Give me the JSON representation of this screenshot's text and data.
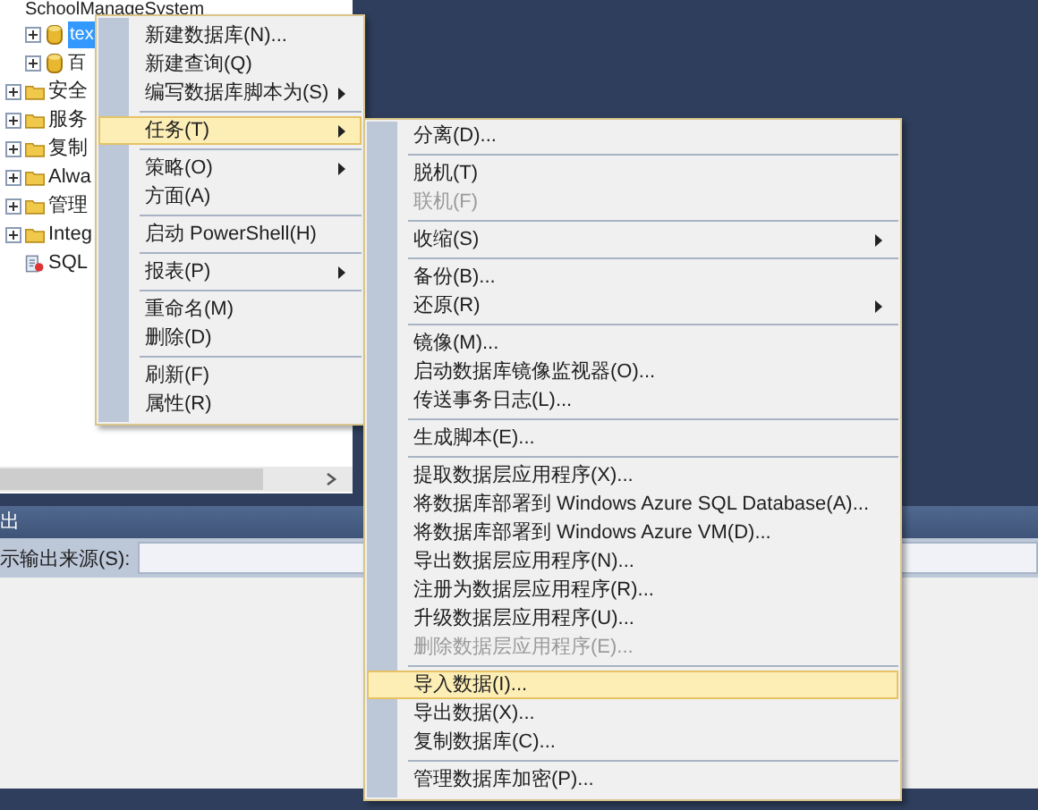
{
  "explorer": {
    "databases": [
      {
        "label": "SchoolManageSystem",
        "selected": false
      },
      {
        "label": "tex",
        "selected": true
      },
      {
        "label": "百",
        "selected": false
      }
    ],
    "folders": [
      {
        "kind": "folder",
        "label": "安全"
      },
      {
        "kind": "folder",
        "label": "服务"
      },
      {
        "kind": "folder",
        "label": "复制"
      },
      {
        "kind": "folder",
        "label": "Alwa"
      },
      {
        "kind": "folder",
        "label": "管理"
      },
      {
        "kind": "folder",
        "label": "Integ"
      },
      {
        "kind": "agent",
        "label": "SQL"
      }
    ]
  },
  "output": {
    "title": "出",
    "source_label": "示输出来源(S):"
  },
  "menus": [
    {
      "items": [
        {
          "kind": "item",
          "label": "新建数据库(N)...",
          "submenu": false,
          "disabled": false,
          "selected": false
        },
        {
          "kind": "item",
          "label": "新建查询(Q)",
          "submenu": false,
          "disabled": false,
          "selected": false
        },
        {
          "kind": "item",
          "label": "编写数据库脚本为(S)",
          "submenu": true,
          "disabled": false,
          "selected": false
        },
        {
          "kind": "separator"
        },
        {
          "kind": "item",
          "label": "任务(T)",
          "submenu": true,
          "disabled": false,
          "selected": true
        },
        {
          "kind": "separator"
        },
        {
          "kind": "item",
          "label": "策略(O)",
          "submenu": true,
          "disabled": false,
          "selected": false
        },
        {
          "kind": "item",
          "label": "方面(A)",
          "submenu": false,
          "disabled": false,
          "selected": false
        },
        {
          "kind": "separator"
        },
        {
          "kind": "item",
          "label": "启动 PowerShell(H)",
          "submenu": false,
          "disabled": false,
          "selected": false
        },
        {
          "kind": "separator"
        },
        {
          "kind": "item",
          "label": "报表(P)",
          "submenu": true,
          "disabled": false,
          "selected": false
        },
        {
          "kind": "separator"
        },
        {
          "kind": "item",
          "label": "重命名(M)",
          "submenu": false,
          "disabled": false,
          "selected": false
        },
        {
          "kind": "item",
          "label": "删除(D)",
          "submenu": false,
          "disabled": false,
          "selected": false
        },
        {
          "kind": "separator"
        },
        {
          "kind": "item",
          "label": "刷新(F)",
          "submenu": false,
          "disabled": false,
          "selected": false
        },
        {
          "kind": "item",
          "label": "属性(R)",
          "submenu": false,
          "disabled": false,
          "selected": false
        }
      ]
    },
    {
      "items": [
        {
          "kind": "item",
          "label": "分离(D)...",
          "submenu": false,
          "disabled": false,
          "selected": false
        },
        {
          "kind": "separator"
        },
        {
          "kind": "item",
          "label": "脱机(T)",
          "submenu": false,
          "disabled": false,
          "selected": false
        },
        {
          "kind": "item",
          "label": "联机(F)",
          "submenu": false,
          "disabled": true,
          "selected": false
        },
        {
          "kind": "separator"
        },
        {
          "kind": "item",
          "label": "收缩(S)",
          "submenu": true,
          "disabled": false,
          "selected": false
        },
        {
          "kind": "separator"
        },
        {
          "kind": "item",
          "label": "备份(B)...",
          "submenu": false,
          "disabled": false,
          "selected": false
        },
        {
          "kind": "item",
          "label": "还原(R)",
          "submenu": true,
          "disabled": false,
          "selected": false
        },
        {
          "kind": "separator"
        },
        {
          "kind": "item",
          "label": "镜像(M)...",
          "submenu": false,
          "disabled": false,
          "selected": false
        },
        {
          "kind": "item",
          "label": "启动数据库镜像监视器(O)...",
          "submenu": false,
          "disabled": false,
          "selected": false
        },
        {
          "kind": "item",
          "label": "传送事务日志(L)...",
          "submenu": false,
          "disabled": false,
          "selected": false
        },
        {
          "kind": "separator"
        },
        {
          "kind": "item",
          "label": "生成脚本(E)...",
          "submenu": false,
          "disabled": false,
          "selected": false
        },
        {
          "kind": "separator"
        },
        {
          "kind": "item",
          "label": "提取数据层应用程序(X)...",
          "submenu": false,
          "disabled": false,
          "selected": false
        },
        {
          "kind": "item",
          "label": "将数据库部署到 Windows Azure SQL Database(A)...",
          "submenu": false,
          "disabled": false,
          "selected": false
        },
        {
          "kind": "item",
          "label": "将数据库部署到 Windows Azure VM(D)...",
          "submenu": false,
          "disabled": false,
          "selected": false
        },
        {
          "kind": "item",
          "label": "导出数据层应用程序(N)...",
          "submenu": false,
          "disabled": false,
          "selected": false
        },
        {
          "kind": "item",
          "label": "注册为数据层应用程序(R)...",
          "submenu": false,
          "disabled": false,
          "selected": false
        },
        {
          "kind": "item",
          "label": "升级数据层应用程序(U)...",
          "submenu": false,
          "disabled": false,
          "selected": false
        },
        {
          "kind": "item",
          "label": "删除数据层应用程序(E)...",
          "submenu": false,
          "disabled": true,
          "selected": false
        },
        {
          "kind": "separator"
        },
        {
          "kind": "item",
          "label": "导入数据(I)...",
          "submenu": false,
          "disabled": false,
          "selected": true
        },
        {
          "kind": "item",
          "label": "导出数据(X)...",
          "submenu": false,
          "disabled": false,
          "selected": false
        },
        {
          "kind": "item",
          "label": "复制数据库(C)...",
          "submenu": false,
          "disabled": false,
          "selected": false
        },
        {
          "kind": "separator"
        },
        {
          "kind": "item",
          "label": "管理数据库加密(P)...",
          "submenu": false,
          "disabled": false,
          "selected": false
        }
      ]
    }
  ]
}
